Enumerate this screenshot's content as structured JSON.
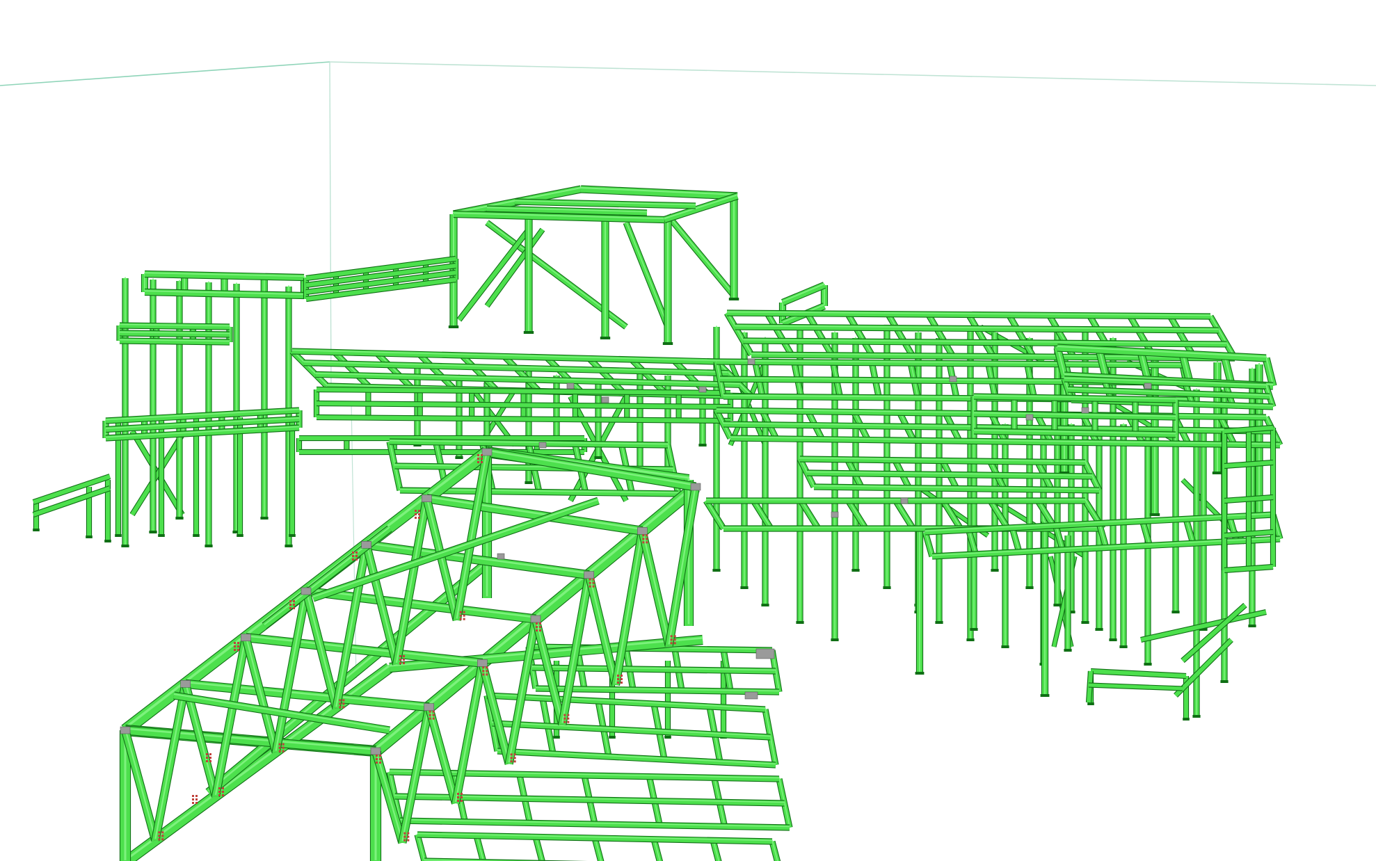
{
  "view": {
    "background": "#ffffff",
    "grid_line_color": "#8ed4b8",
    "guide_line_color": "#bfe3d4"
  },
  "model": {
    "member_fill": "#4de04d",
    "member_highlight": "#7df27d",
    "member_outline": "#0f6e14",
    "connection_plate_color": "#9a9a9a",
    "bolt_color": "#c0403a"
  }
}
